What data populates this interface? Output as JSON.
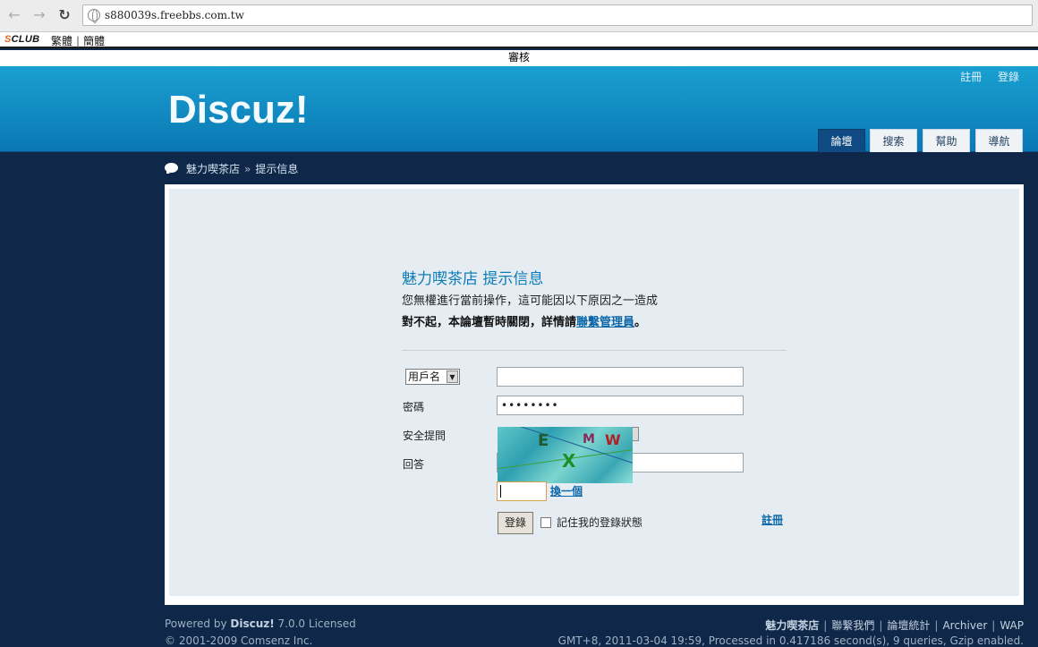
{
  "browser": {
    "url": "s880039s.freebbs.com.tw",
    "back_icon": "←",
    "forward_icon": "→",
    "reload_icon": "↻"
  },
  "bookmarks": {
    "sclub_s": "S",
    "sclub_rest": "CLUB",
    "traditional": "繁體",
    "simplified": "簡體"
  },
  "strip": {
    "text": "審核"
  },
  "header": {
    "logo": "Discuz!",
    "register": "註冊",
    "login": "登錄",
    "tabs": [
      "論壇",
      "搜索",
      "幫助",
      "導航"
    ]
  },
  "breadcrumb": {
    "forum": "魅力喫茶店",
    "sep": "»",
    "page": "提示信息"
  },
  "message": {
    "title": "魅力喫茶店 提示信息",
    "line1": "您無權進行當前操作，這可能因以下原因之一造成",
    "line2_prefix": "對不起，本論壇暫時關閉，詳情請",
    "line2_link": "聯繫管理員",
    "line2_suffix": "。"
  },
  "form": {
    "username_select": "用戶名",
    "password_label": "密碼",
    "password_value": "••••••••",
    "security_question_label": "安全提問",
    "answer_label": "回答",
    "change_captcha": "換一個",
    "login_button": "登錄",
    "remember_label": "記住我的登錄狀態",
    "register_link": "註冊"
  },
  "footer": {
    "powered_prefix": "Powered by ",
    "powered_name": "Discuz!",
    "powered_suffix": " 7.0.0 Licensed",
    "copyright": "© 2001-2009 Comsenz Inc.",
    "links": [
      "魅力喫茶店",
      "聯繫我們",
      "論壇統計",
      "Archiver",
      "WAP"
    ],
    "status": "GMT+8, 2011-03-04 19:59, Processed in 0.417186 second(s), 9 queries, Gzip enabled."
  }
}
